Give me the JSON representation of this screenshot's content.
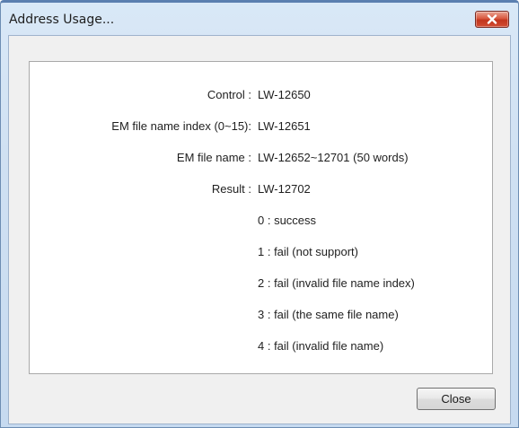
{
  "window": {
    "title": "Address Usage..."
  },
  "details": {
    "control": {
      "label": "Control :",
      "value": "LW-12650"
    },
    "em_index": {
      "label": "EM file name index (0~15):",
      "value": "LW-12651"
    },
    "em_name": {
      "label": "EM file name :",
      "value": "LW-12652~12701 (50 words)"
    },
    "result": {
      "label": "Result :",
      "value": "LW-12702"
    },
    "result_codes": [
      "0 : success",
      "1 : fail (not support)",
      "2 : fail (invalid file name index)",
      "3 : fail (the same file name)",
      "4 : fail (invalid file name)"
    ]
  },
  "buttons": {
    "close_label": "Close"
  },
  "icons": {
    "title_close": "close-icon"
  },
  "colors": {
    "titlebar": "#cfe0f2",
    "close_button_red": "#c2361e",
    "panel_background": "#ffffff",
    "client_background": "#f0f0f0"
  }
}
